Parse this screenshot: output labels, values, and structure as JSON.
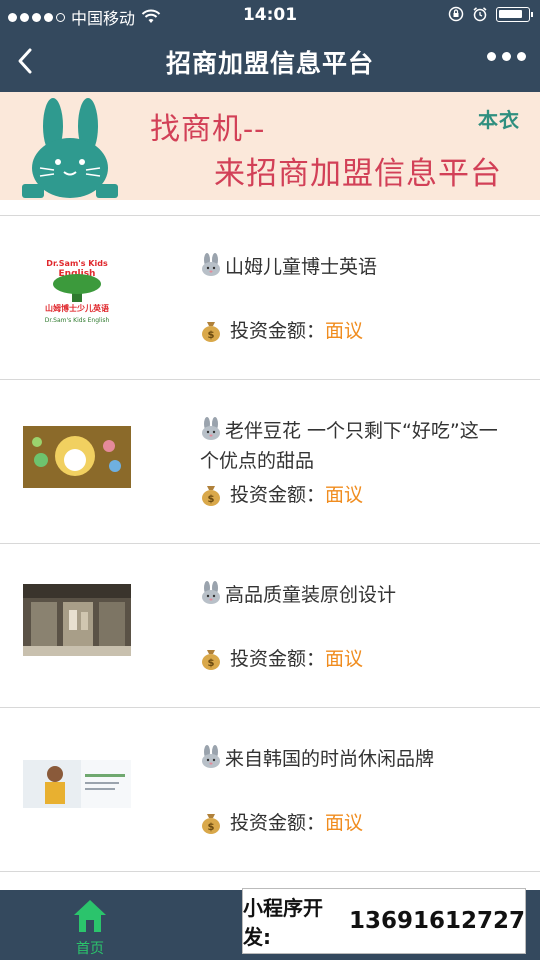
{
  "status_bar": {
    "carrier": "中国移动",
    "time": "14:01",
    "signal_dots_filled": 4,
    "signal_dots_total": 5,
    "battery_level": 0.85
  },
  "nav": {
    "title": "招商加盟信息平台"
  },
  "banner": {
    "line1": "找商机--",
    "line2": "来招商加盟信息平台",
    "tag": "本衣"
  },
  "items": [
    {
      "name": "山姆儿童博士英语",
      "price_label": "投资金额：",
      "price_value": "面议",
      "image": "dr-sams-kids-english-logo"
    },
    {
      "name": "老伴豆花 一个只剩下“好吃”这一个优点的甜品",
      "price_label": "投资金额：",
      "price_value": "面议",
      "image": "doufu-pudding-poster"
    },
    {
      "name": "高品质童装原创设计",
      "price_label": "投资金额：",
      "price_value": "面议",
      "image": "clothing-store-photo"
    },
    {
      "name": "来自韩国的时尚休闲品牌",
      "price_label": "投资金额：",
      "price_value": "面议",
      "image": "fashion-brand-photo"
    }
  ],
  "tabbar": {
    "home_label": "首页"
  },
  "promo": {
    "label": "小程序开发:",
    "phone": "13691612727"
  },
  "colors": {
    "nav_bg": "#34495e",
    "accent_green": "#2bc46c",
    "price_orange": "#f08c1e",
    "banner_bg": "#fbe8da",
    "banner_text": "#d24057"
  }
}
